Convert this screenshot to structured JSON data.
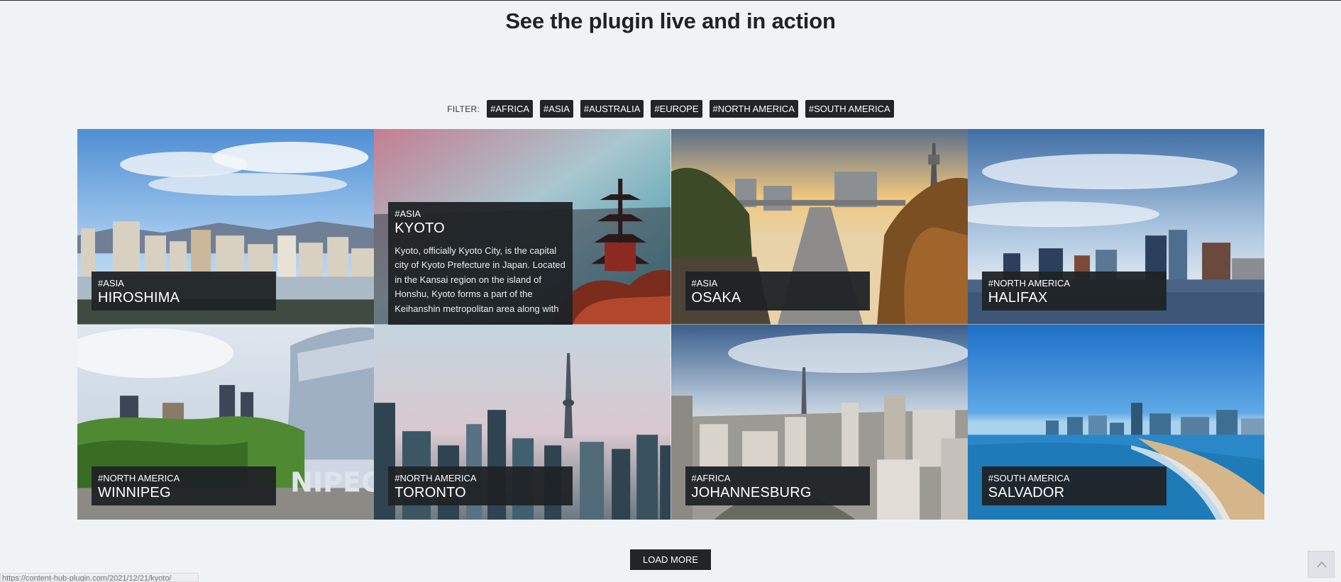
{
  "heading": "See the plugin live and in action",
  "filter": {
    "label": "FILTER:",
    "tags": [
      "#AFRICA",
      "#ASIA",
      "#AUSTRALIA",
      "#EUROPE",
      "#NORTH AMERICA",
      "#SOUTH AMERICA"
    ]
  },
  "cards": [
    {
      "tag": "#ASIA",
      "title": "HIROSHIMA",
      "image_icon": "city-skyline-photo"
    },
    {
      "tag": "#ASIA",
      "title": "KYOTO",
      "description": "Kyoto, officially Kyoto City, is the capital city of Kyoto Prefecture in Japan. Located in the Kansai region on the island of Honshu, Kyoto forms a part of the Keihanshin metropolitan area along with",
      "image_icon": "pagoda-photo"
    },
    {
      "tag": "#ASIA",
      "title": "OSAKA",
      "image_icon": "tower-avenue-photo"
    },
    {
      "tag": "#NORTH AMERICA",
      "title": "HALIFAX",
      "image_icon": "waterfront-skyline-photo"
    },
    {
      "tag": "#NORTH AMERICA",
      "title": "WINNIPEG",
      "image_icon": "park-skyline-photo"
    },
    {
      "tag": "#NORTH AMERICA",
      "title": "TORONTO",
      "image_icon": "cn-tower-photo"
    },
    {
      "tag": "#AFRICA",
      "title": "JOHANNESBURG",
      "image_icon": "cityscape-tower-photo"
    },
    {
      "tag": "#SOUTH AMERICA",
      "title": "SALVADOR",
      "image_icon": "beach-city-photo"
    }
  ],
  "load_more": "LOAD MORE",
  "status_url": "https://content-hub-plugin.com/2021/12/21/kyoto/",
  "colors": {
    "background": "#f0f3f6",
    "button": "#212529",
    "caption": "#1f2326"
  }
}
